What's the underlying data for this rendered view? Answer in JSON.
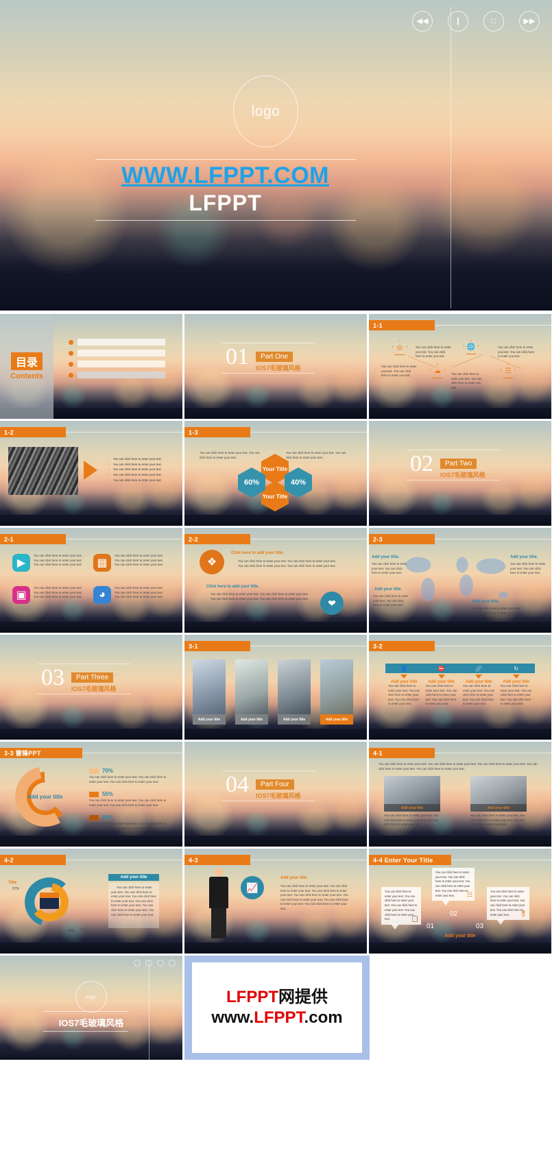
{
  "hero": {
    "logo": "logo",
    "site": "WWW.LFPPT.COM",
    "brand": "LFPPT",
    "controls": [
      "rewind-icon",
      "pause-icon",
      "stop-icon",
      "forward-icon"
    ]
  },
  "slides": {
    "contents": {
      "cn": "目录",
      "en": "Contents",
      "rows": [
        "",
        "",
        "",
        ""
      ]
    },
    "part_one": {
      "num": "01",
      "chip": "Part One",
      "sub": "IOS7毛玻璃风格"
    },
    "part_two": {
      "num": "02",
      "chip": "Part Two",
      "sub": "IOS7毛玻璃风格"
    },
    "part_three": {
      "num": "03",
      "chip": "Part Three",
      "sub": "IOS7毛玻璃风格"
    },
    "part_four": {
      "num": "04",
      "chip": "Part Four",
      "sub": "IOS7毛玻璃风格"
    },
    "s11": {
      "tag": "1-1",
      "items": [
        {
          "icon": "network-icon",
          "text": "You can click here to enter you text. You can click here to enter you text."
        },
        {
          "icon": "cloud-icon",
          "text": "You can click here to enter you text. You can click here to enter you text."
        },
        {
          "icon": "globe-icon",
          "text": "You can click here to enter you text. You can click here to enter you text."
        },
        {
          "icon": "bulb-icon",
          "text": "You can click here to enter you text. You can click here to enter you text."
        }
      ]
    },
    "s12": {
      "tag": "1-2",
      "bullets": [
        "You can click here to enter your text.",
        "You can click here to enter your text.",
        "You can click here to enter your text.",
        "You can click here to enter your text.",
        "You can click here to enter your text."
      ]
    },
    "s13": {
      "tag": "1-3",
      "left_text": "You can click here to enter your text. You can click here to enter your text.",
      "right_text": "You can click here to enter your text. You can click here to enter your text.",
      "hex_top": "Your Title",
      "hex_bottom": "Your Title",
      "left_pct": "60%",
      "right_pct": "40%"
    },
    "s21": {
      "tag": "2-1",
      "cells": [
        {
          "icon": "play-icon",
          "color": "#2bb5c8",
          "lines": [
            "You can click here to enter your text.",
            "You can click here to enter your text.",
            "You can click here to enter your text."
          ]
        },
        {
          "icon": "grid-icon",
          "color": "#e0751a",
          "lines": [
            "You can click here to enter your text.",
            "You can click here to enter your text.",
            "You can click here to enter your text."
          ]
        },
        {
          "icon": "film-icon",
          "color": "#d6318a",
          "lines": [
            "You can click here to enter your text.",
            "You can click here to enter your text.",
            "You can click here to enter your text."
          ]
        },
        {
          "icon": "headphones-icon",
          "color": "#3585d4",
          "lines": [
            "You can click here to enter your text.",
            "You can click here to enter your text.",
            "You can click here to enter your text."
          ]
        }
      ]
    },
    "s22": {
      "tag": "2-2",
      "title1": "Click here to add your title.",
      "body1": "You can click here to enter your text. You can click here to enter your text. You can click here to enter your text. You can click here to enter your text.",
      "title2": "Click here to add your title.",
      "body2": "You can click here to enter your text. You can click here to enter your text. You can click here to enter your text. You can click here to enter your text.",
      "icon1": "boxes-icon",
      "icon2": "heart-icon"
    },
    "s23": {
      "tag": "2-3",
      "callouts": [
        {
          "title": "Add your title.",
          "text": "You can click here to enter your text. You can click here to enter your text."
        },
        {
          "title": "Add your title.",
          "text": "You can click here to enter your text. You can click here to enter your text."
        },
        {
          "title": "Add your title.",
          "text": "You can click here to enter your text. You can click here to enter your text."
        },
        {
          "title": "Add your title.",
          "text": "You can click here to enter your text. You can click here to enter your text."
        }
      ]
    },
    "s31": {
      "tag": "3-1",
      "cards": [
        {
          "caption": "Add your title",
          "active": false
        },
        {
          "caption": "Add your title",
          "active": false
        },
        {
          "caption": "Add your title",
          "active": false
        },
        {
          "caption": "Add your title",
          "active": true
        }
      ]
    },
    "s32": {
      "tag": "3-2",
      "icons": [
        "person-icon",
        "no-entry-icon",
        "link-icon",
        "refresh-icon"
      ],
      "cols": [
        {
          "title": "Add your title",
          "text": "You can click here to enter your text. You can click here to enter your text. You can click here to enter your text."
        },
        {
          "title": "Add your title",
          "text": "You can click here to enter your text. You can click here to enter your text. You can click here to enter your text."
        },
        {
          "title": "Add your title",
          "text": "You can click here to enter your text. You can click here to enter your text. You can click here to enter your text."
        },
        {
          "title": "Add your title",
          "text": "You can click here to enter your text. You can click here to enter your text. You can click here to enter your text."
        }
      ]
    },
    "s33": {
      "tag": "3-3 雷锋PPT",
      "donut_label": "Add your title",
      "rows": [
        {
          "pct": "70%",
          "swatch": "#f5c08a",
          "text": "You can click here to enter your text. You can click here to enter your text. You can click here to enter your text."
        },
        {
          "pct": "55%",
          "swatch": "#e87b17",
          "text": "You can click here to enter your text. You can click here to enter your text. You can click here to enter your text."
        },
        {
          "pct": "40%",
          "swatch": "#b4560c",
          "text": "You can click here to enter your text. You can click here to enter your text. You can click here to enter your text."
        }
      ]
    },
    "s41": {
      "tag": "4-1",
      "intro": "You can click here to enter your text. You can click here to enter your text. You can click here to enter your text. You can click here to enter your text. You can click here to enter your text.",
      "cards": [
        {
          "caption": "Add your title",
          "text": "You can click here to enter your text. You can click here to enter your text. You can click here to enter your text."
        },
        {
          "caption": "Add your title",
          "text": "You can click here to enter your text. You can click here to enter your text. You can click here to enter your text."
        }
      ]
    },
    "s42": {
      "tag": "4-2",
      "icon": "briefcase-icon",
      "left_label": "Title",
      "left_pct": "57%",
      "right_label": "Title",
      "right_pct": "43%",
      "panel_title": "Add your title",
      "panel_text": "You can click here to enter your text. You can click here to enter your text. You can click here to enter your text. You can click here to enter your text. You can click here to enter your text. You can click here to enter your text."
    },
    "s43": {
      "tag": "4-3",
      "icon": "chart-board-icon",
      "title": "Add your title",
      "text": "You can click here to enter your text. You can click here to enter your text. You can click here to enter your text. You can click here to enter your text. You can click here to enter your text. You can click here to enter your text. You can click here to enter your text."
    },
    "s44": {
      "tag": "4-4 Enter Your Title",
      "footer": "Add your title",
      "items": [
        {
          "num": "01",
          "icon": "clipboard-icon",
          "text": "You can click here to enter your text. You can click here to enter your text. You can click here to enter your text. You can click here to enter your text."
        },
        {
          "num": "02",
          "icon": "network-box-icon",
          "text": "You can click here to enter your text. You can click here to enter your text. You can click here to enter your text. You can click here to enter your text."
        },
        {
          "num": "03",
          "icon": "badge-icon",
          "text": "You can click here to enter your text. You can click here to enter your text. You can click here to enter your text. You can click here to enter your text."
        }
      ]
    },
    "ending": {
      "logo": "logo",
      "title": "IOS7毛玻璃风格"
    },
    "promo": {
      "line1_red": "LFPPT",
      "line1_black": "网提供",
      "line2_a": "www.",
      "line2_red": "LFPPT",
      "line2_b": ".com"
    }
  }
}
